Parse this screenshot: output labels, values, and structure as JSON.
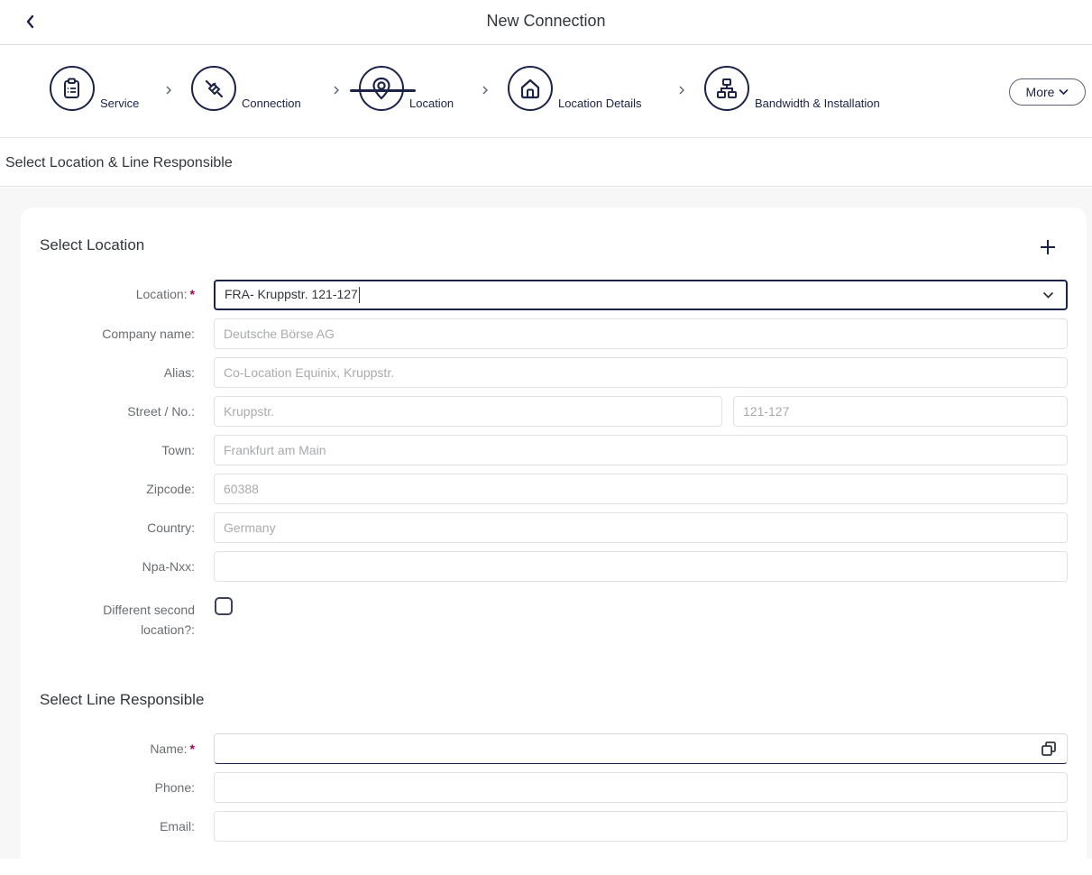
{
  "header": {
    "title": "New Connection"
  },
  "steps": [
    {
      "label": "Service",
      "icon": "clipboard-icon"
    },
    {
      "label": "Connection",
      "icon": "plug-icon"
    },
    {
      "label": "Location",
      "icon": "location-pin-icon"
    },
    {
      "label": "Location Details",
      "icon": "home-icon"
    },
    {
      "label": "Bandwidth & Installation",
      "icon": "network-icon"
    }
  ],
  "more_button": {
    "label": "More"
  },
  "subheader": {
    "text": "Select Location & Line Responsible"
  },
  "location_section": {
    "title": "Select Location",
    "fields": {
      "location": {
        "label": "Location:",
        "value": "FRA- Kruppstr. 121-127"
      },
      "company_name": {
        "label": "Company name:",
        "value": "Deutsche Börse AG"
      },
      "alias": {
        "label": "Alias:",
        "value": "Co-Location Equinix, Kruppstr."
      },
      "street": {
        "label": "Street / No.:",
        "value": "Kruppstr.",
        "number": "121-127"
      },
      "town": {
        "label": "Town:",
        "value": "Frankfurt am Main"
      },
      "zipcode": {
        "label": "Zipcode:",
        "value": "60388"
      },
      "country": {
        "label": "Country:",
        "value": "Germany"
      },
      "npa_nxx": {
        "label": "Npa-Nxx:",
        "value": ""
      },
      "second_location": {
        "label_line1": "Different second",
        "label_line2": "location?:"
      }
    }
  },
  "line_section": {
    "title": "Select Line Responsible",
    "fields": {
      "name": {
        "label": "Name:",
        "value": ""
      },
      "phone": {
        "label": "Phone:",
        "value": ""
      },
      "email": {
        "label": "Email:",
        "value": ""
      }
    }
  },
  "required_marker": "*",
  "colors": {
    "primary": "#1c2348",
    "required": "#a8005a",
    "background": "#f7f7f7"
  }
}
